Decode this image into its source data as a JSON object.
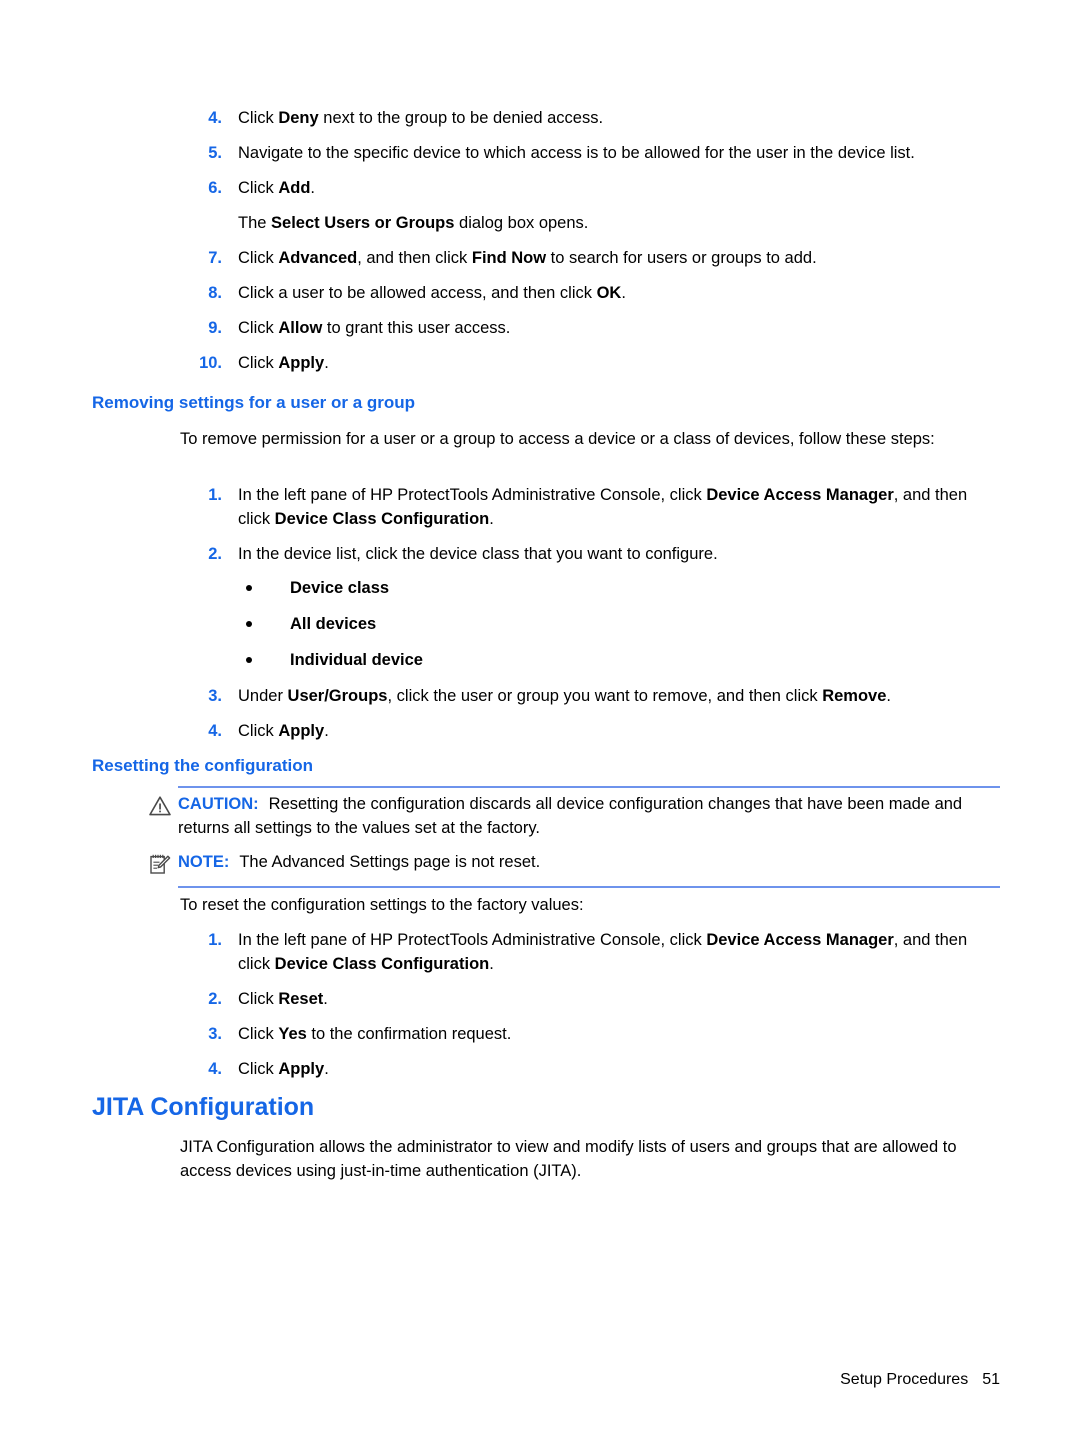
{
  "doc": {
    "steps_top": [
      {
        "num": "4.",
        "parts": [
          {
            "t": "Click ",
            "b": false
          },
          {
            "t": "Deny",
            "b": true
          },
          {
            "t": " next to the group to be denied access.",
            "b": false
          }
        ]
      },
      {
        "num": "5.",
        "parts": [
          {
            "t": "Navigate to the specific device to which access is to be allowed for the user in the device list.",
            "b": false
          }
        ]
      },
      {
        "num": "6.",
        "parts": [
          {
            "t": "Click ",
            "b": false
          },
          {
            "t": "Add",
            "b": true
          },
          {
            "t": ".",
            "b": false
          }
        ],
        "sub": [
          {
            "t": "The ",
            "b": false
          },
          {
            "t": "Select Users or Groups",
            "b": true
          },
          {
            "t": " dialog box opens.",
            "b": false
          }
        ]
      },
      {
        "num": "7.",
        "parts": [
          {
            "t": "Click ",
            "b": false
          },
          {
            "t": "Advanced",
            "b": true
          },
          {
            "t": ", and then click ",
            "b": false
          },
          {
            "t": "Find Now",
            "b": true
          },
          {
            "t": " to search for users or groups to add.",
            "b": false
          }
        ]
      },
      {
        "num": "8.",
        "parts": [
          {
            "t": "Click a user to be allowed access, and then click ",
            "b": false
          },
          {
            "t": "OK",
            "b": true
          },
          {
            "t": ".",
            "b": false
          }
        ]
      },
      {
        "num": "9.",
        "parts": [
          {
            "t": "Click ",
            "b": false
          },
          {
            "t": "Allow",
            "b": true
          },
          {
            "t": " to grant this user access.",
            "b": false
          }
        ]
      },
      {
        "num": "10.",
        "parts": [
          {
            "t": "Click ",
            "b": false
          },
          {
            "t": "Apply",
            "b": true
          },
          {
            "t": ".",
            "b": false
          }
        ]
      }
    ],
    "section_removing": {
      "heading": "Removing settings for a user or a group",
      "intro": "To remove permission for a user or a group to access a device or a class of devices, follow these steps:",
      "steps": [
        {
          "num": "1.",
          "parts": [
            {
              "t": "In the left pane of HP ProtectTools Administrative Console, click ",
              "b": false
            },
            {
              "t": "Device Access Manager",
              "b": true
            },
            {
              "t": ", and then click ",
              "b": false
            },
            {
              "t": "Device Class Configuration",
              "b": true
            },
            {
              "t": ".",
              "b": false
            }
          ]
        },
        {
          "num": "2.",
          "parts": [
            {
              "t": "In the device list, click the device class that you want to configure.",
              "b": false
            }
          ],
          "bullets": [
            "Device class",
            "All devices",
            "Individual device"
          ]
        },
        {
          "num": "3.",
          "parts": [
            {
              "t": "Under ",
              "b": false
            },
            {
              "t": "User/Groups",
              "b": true
            },
            {
              "t": ", click the user or group you want to remove, and then click ",
              "b": false
            },
            {
              "t": "Remove",
              "b": true
            },
            {
              "t": ".",
              "b": false
            }
          ]
        },
        {
          "num": "4.",
          "parts": [
            {
              "t": "Click ",
              "b": false
            },
            {
              "t": "Apply",
              "b": true
            },
            {
              "t": ".",
              "b": false
            }
          ]
        }
      ]
    },
    "section_resetting": {
      "heading": "Resetting the configuration",
      "caution": {
        "icon": "warning-triangle-icon",
        "label": "CAUTION:",
        "text": "Resetting the configuration discards all device configuration changes that have been made and returns all settings to the values set at the factory."
      },
      "note": {
        "icon": "notepad-pencil-icon",
        "label": "NOTE:",
        "text": "The Advanced Settings page is not reset."
      },
      "intro": "To reset the configuration settings to the factory values:",
      "steps": [
        {
          "num": "1.",
          "parts": [
            {
              "t": "In the left pane of HP ProtectTools Administrative Console, click ",
              "b": false
            },
            {
              "t": "Device Access Manager",
              "b": true
            },
            {
              "t": ", and then click ",
              "b": false
            },
            {
              "t": "Device Class Configuration",
              "b": true
            },
            {
              "t": ".",
              "b": false
            }
          ]
        },
        {
          "num": "2.",
          "parts": [
            {
              "t": "Click ",
              "b": false
            },
            {
              "t": "Reset",
              "b": true
            },
            {
              "t": ".",
              "b": false
            }
          ]
        },
        {
          "num": "3.",
          "parts": [
            {
              "t": "Click ",
              "b": false
            },
            {
              "t": "Yes",
              "b": true
            },
            {
              "t": " to the confirmation request.",
              "b": false
            }
          ]
        },
        {
          "num": "4.",
          "parts": [
            {
              "t": "Click ",
              "b": false
            },
            {
              "t": "Apply",
              "b": true
            },
            {
              "t": ".",
              "b": false
            }
          ]
        }
      ]
    },
    "section_jita": {
      "heading": "JITA Configuration",
      "body": "JITA Configuration allows the administrator to view and modify lists of users and groups that are allowed to access devices using just-in-time authentication (JITA)."
    },
    "footer": {
      "label": "Setup Procedures",
      "page": "51"
    },
    "colors": {
      "heading_blue": "#1566E6",
      "number_blue": "#1566E6",
      "rule_blue": "#6E93EC",
      "text_black": "#000000"
    }
  }
}
